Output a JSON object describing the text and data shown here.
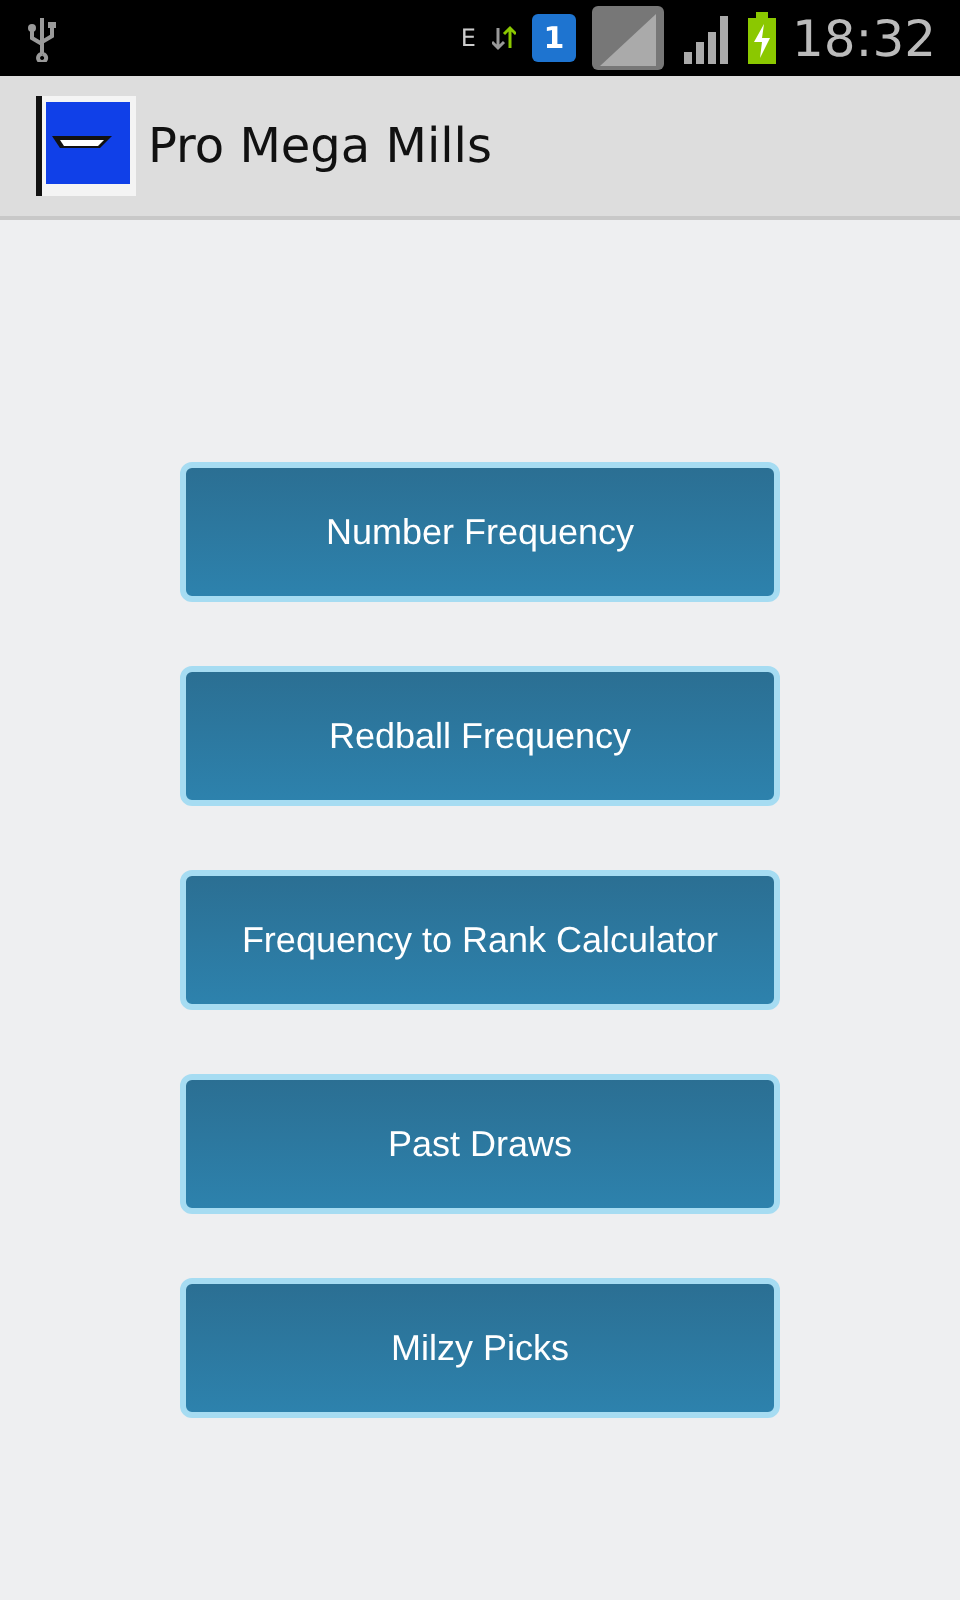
{
  "status_bar": {
    "network_type": "E",
    "sim_slot": "1",
    "time": "18:32"
  },
  "action_bar": {
    "title": "Pro Mega Mills"
  },
  "buttons": [
    {
      "label": "Number Frequency"
    },
    {
      "label": "Redball Frequency"
    },
    {
      "label": "Frequency to Rank Calculator"
    },
    {
      "label": "Past Draws"
    },
    {
      "label": "Milzy Picks"
    }
  ]
}
